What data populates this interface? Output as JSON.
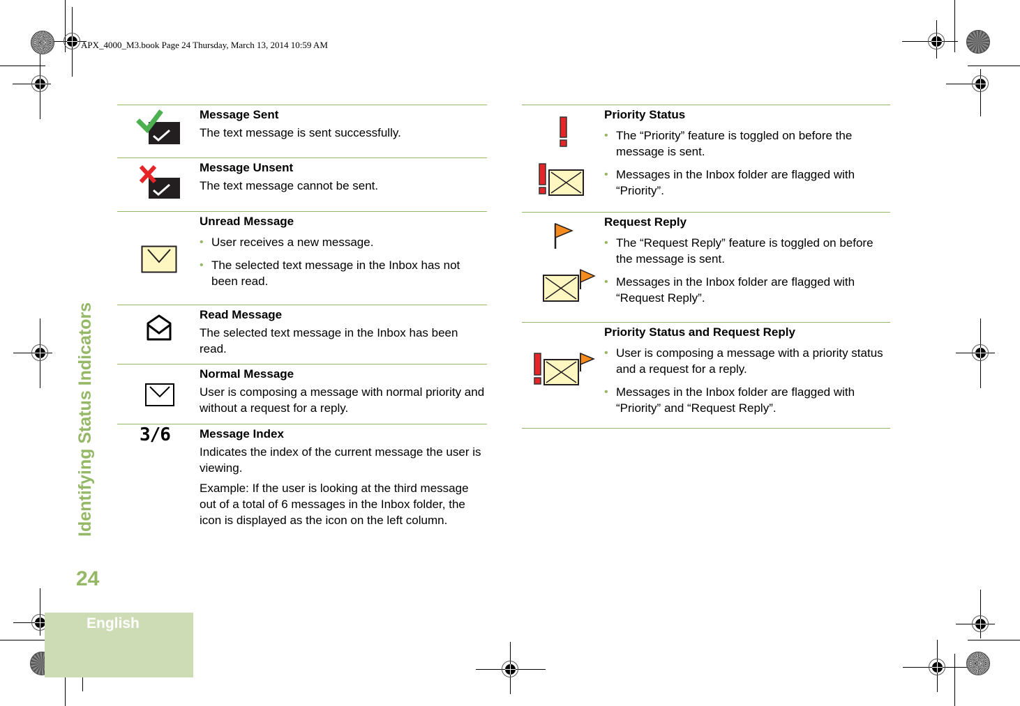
{
  "header": {
    "print_info": "APX_4000_M3.book  Page 24  Thursday, March 13, 2014  10:59 AM"
  },
  "sidebar": {
    "section_title": "Identifying Status Indicators",
    "page_number": "24",
    "language": "English"
  },
  "colors": {
    "accent_green": "#95b866",
    "tab_background": "#cddcb5",
    "check_green": "#4caf50",
    "cross_red": "#e52528",
    "envelope_yellow": "#fff7c2",
    "flag_orange": "#f58a1f",
    "priority_red": "#e52528"
  },
  "left_table": {
    "rows": [
      {
        "icon": "message-sent-icon",
        "title": "Message Sent",
        "description": "The text message is sent successfully."
      },
      {
        "icon": "message-unsent-icon",
        "title": "Message Unsent",
        "description": "The text message cannot be sent."
      },
      {
        "icon": "unread-message-icon",
        "title": "Unread Message",
        "bullets": [
          "User receives a new message.",
          "The selected text message in the Inbox has not been read."
        ]
      },
      {
        "icon": "read-message-icon",
        "title": "Read Message",
        "description": "The selected text message in the Inbox has been read."
      },
      {
        "icon": "normal-message-icon",
        "title": "Normal Message",
        "description": "User is composing a message with normal priority and without a request for a reply."
      },
      {
        "icon": "message-index-icon",
        "icon_text": "3/6",
        "title": "Message Index",
        "paragraphs": [
          "Indicates the index of the current message the user is viewing.",
          "Example: If the user is looking at the third message out of a total of 6 messages in the Inbox folder, the icon is displayed as the icon on the left column."
        ]
      }
    ]
  },
  "right_table": {
    "rows": [
      {
        "icon": "priority-status-icon",
        "title": "Priority Status",
        "bullets": [
          "The “Priority” feature is toggled on before the message is sent.",
          "Messages in the Inbox folder are flagged with “Priority”."
        ]
      },
      {
        "icon": "request-reply-icon",
        "title": "Request Reply",
        "bullets": [
          "The “Request Reply” feature is toggled on before the message is sent.",
          "Messages in the Inbox folder are flagged with “Request Reply”."
        ]
      },
      {
        "icon": "priority-and-reply-icon",
        "title": "Priority Status and Request Reply",
        "bullets": [
          "User is composing a message with a priority status and a request for a reply.",
          "Messages in the Inbox folder are flagged with “Priority” and “Request Reply”."
        ]
      }
    ]
  }
}
